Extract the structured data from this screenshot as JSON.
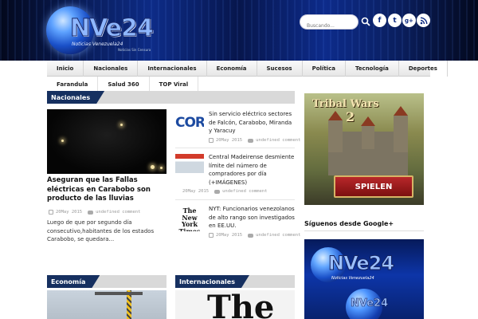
{
  "header": {
    "logo_text": "NVe24",
    "logo_subtitle": "Noticias Venezuela24",
    "logo_tagline": "Noticias Sin Censura",
    "search_placeholder": "Buscando...",
    "social": [
      "f",
      "t",
      "g+",
      "rss"
    ]
  },
  "nav": {
    "row1": [
      "Inicio",
      "Nacionales",
      "Internacionales",
      "Economía",
      "Sucesos",
      "Política",
      "Tecnología",
      "Deportes"
    ],
    "row2": [
      "Farandula",
      "Salud 360",
      "TOP Viral"
    ]
  },
  "nacionales": {
    "section_title": "Nacionales",
    "featured": {
      "title": "Aseguran que las Fallas eléctricas en Carabobo son producto de las lluvias",
      "date": "20May 2015",
      "comments": "undefined comment",
      "excerpt": "Luego de que por segundo día consecutivo,habitantes de los estados Carabobo, se quedara..."
    },
    "list": [
      {
        "thumb_text": "CORI",
        "title": "Sin servicio eléctrico sectores de Falcón, Carabobo, Miranda y Yaracuy",
        "date": "20May 2015",
        "comments": "undefined comment"
      },
      {
        "thumb_text": "",
        "title": "Central Madeirense desmiente límite del número de compradores por día (+IMÁGENES)",
        "date": "20May 2015",
        "comments": "undefined comment"
      },
      {
        "thumb_text": "The New York Times",
        "title": "NYT: Funcionarios venezolanos de alto rango son investigados en EE.UU.",
        "date": "20May 2015",
        "comments": "undefined comment"
      }
    ]
  },
  "economia": {
    "section_title": "Economía"
  },
  "internacionales": {
    "section_title": "Internacionales",
    "image_text": "The"
  },
  "sidebar": {
    "ad": {
      "title": "Tribal Wars",
      "number": "2",
      "button": "SPIELEN"
    },
    "follow_title": "Síguenos desde Google+",
    "gp_logo_text": "NVe24",
    "gp_logo_subtitle": "Noticias Venezuela24"
  },
  "colors": {
    "section_tab": "#163060",
    "header_accent": "#0d2b86"
  }
}
